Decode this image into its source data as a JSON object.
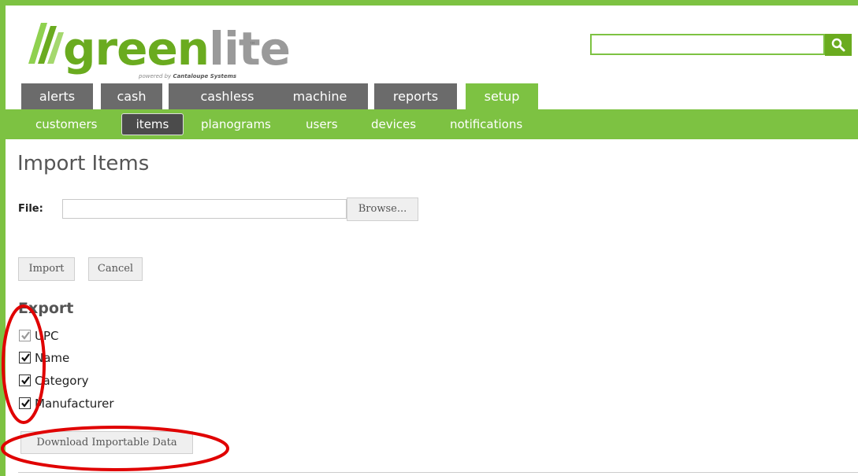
{
  "logo": {
    "brand_green": "green",
    "brand_gray": "lite",
    "trademark": "™",
    "powered_by": "powered by",
    "company": "Cantaloupe Systems"
  },
  "search": {
    "placeholder": "",
    "value": "",
    "icon": "search-icon"
  },
  "main_tabs": [
    {
      "label": "alerts",
      "active": false
    },
    {
      "label": "cash",
      "active": false
    },
    {
      "label": "cashless",
      "active": false
    },
    {
      "label": "machine",
      "active": false
    },
    {
      "label": "reports",
      "active": false
    },
    {
      "label": "setup",
      "active": true
    }
  ],
  "sub_nav": [
    {
      "label": "customers",
      "active": false
    },
    {
      "label": "items",
      "active": true
    },
    {
      "label": "planograms",
      "active": false
    },
    {
      "label": "users",
      "active": false
    },
    {
      "label": "devices",
      "active": false
    },
    {
      "label": "notifications",
      "active": false
    }
  ],
  "page": {
    "title": "Import Items",
    "file_label": "File:",
    "file_value": "",
    "browse_label": "Browse...",
    "import_label": "Import",
    "cancel_label": "Cancel"
  },
  "export": {
    "title": "Export",
    "options": [
      {
        "label": "UPC",
        "checked": true,
        "disabled": true
      },
      {
        "label": "Name",
        "checked": true,
        "disabled": false
      },
      {
        "label": "Category",
        "checked": true,
        "disabled": false
      },
      {
        "label": "Manufacturer",
        "checked": true,
        "disabled": false
      }
    ],
    "download_label": "Download Importable Data"
  },
  "colors": {
    "accent_green": "#7dc242",
    "tab_gray": "#6b6b6b",
    "active_subitem": "#4b4b4b",
    "annotation_red": "#e00000"
  }
}
